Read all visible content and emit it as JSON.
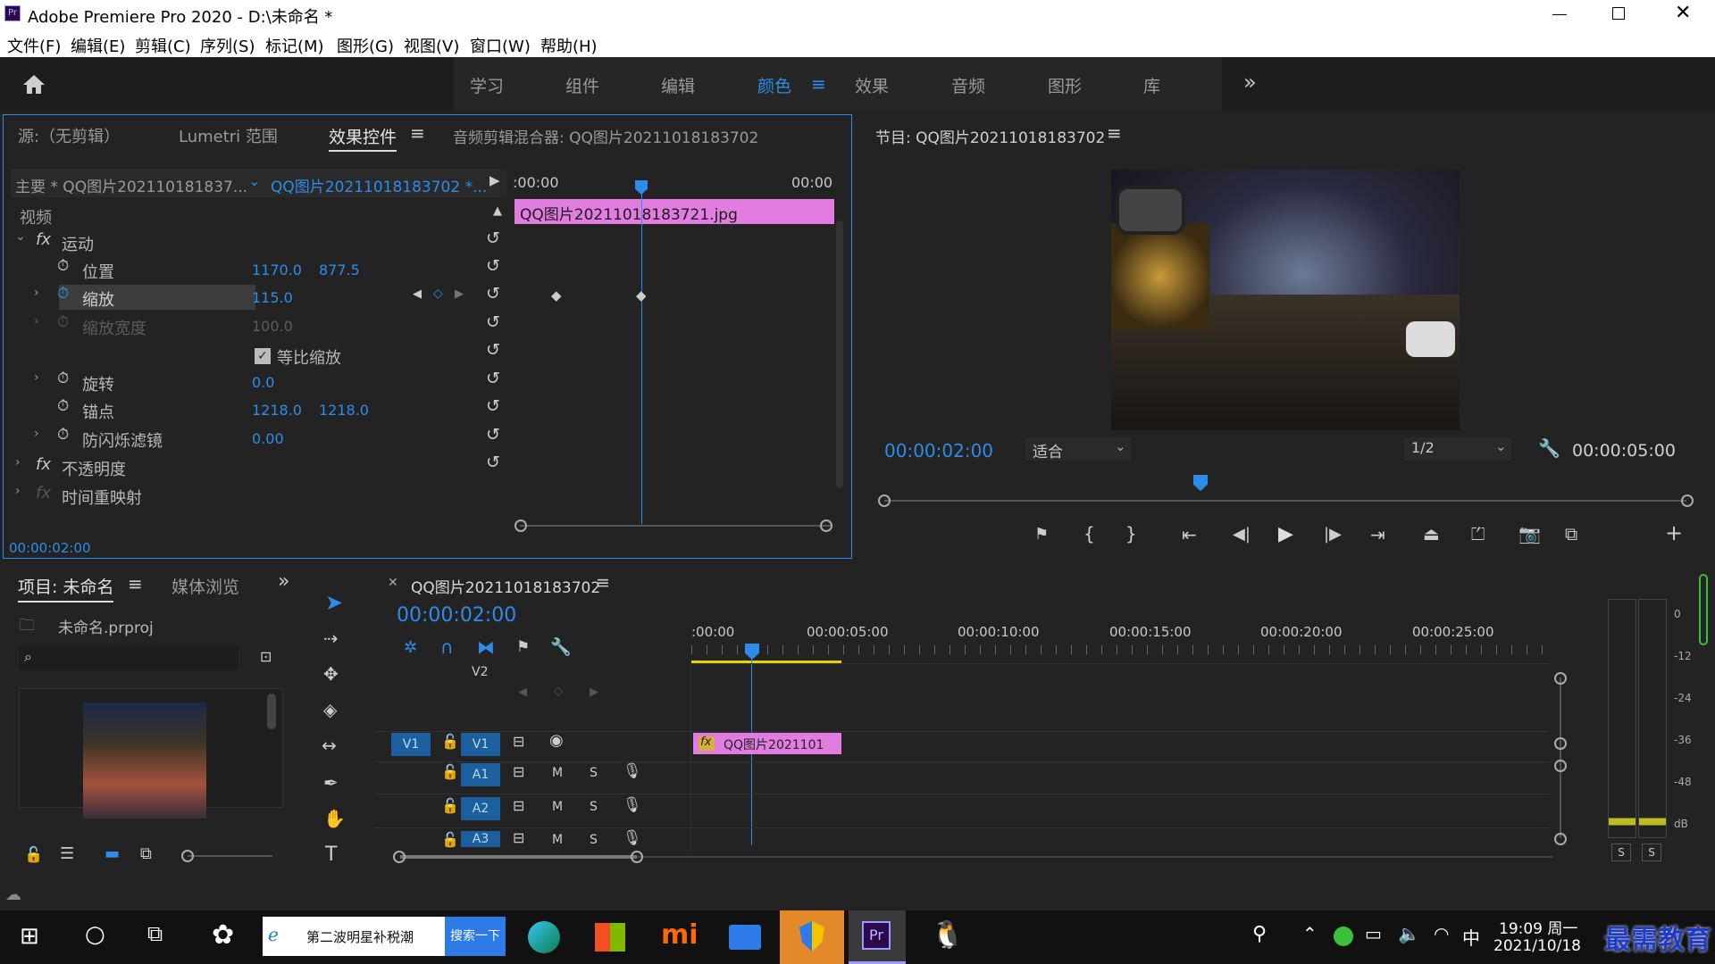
{
  "window": {
    "title": "Adobe Premiere Pro 2020 - D:\\未命名 *"
  },
  "menu": [
    "文件(F)",
    "编辑(E)",
    "剪辑(C)",
    "序列(S)",
    "标记(M)",
    "图形(G)",
    "视图(V)",
    "窗口(W)",
    "帮助(H)"
  ],
  "workspaces": [
    "学习",
    "组件",
    "编辑",
    "颜色",
    "效果",
    "音频",
    "图形",
    "库"
  ],
  "active_workspace": "颜色",
  "source_tabs": [
    "源:（无剪辑）",
    "Lumetri 范围",
    "效果控件",
    "音频剪辑混合器: QQ图片20211018183702"
  ],
  "ec": {
    "master": "主要 * QQ图片202110181837...",
    "clip": "QQ图片20211018183702 *...",
    "tc_start": ":00:00",
    "tc_end": "00:00",
    "clip_bar": "QQ图片20211018183721.jpg",
    "video_label": "视频",
    "motion": "运动",
    "position": "位置",
    "pos_x": "1170.0",
    "pos_y": "877.5",
    "scale": "缩放",
    "scale_val": "115.0",
    "scale_width": "缩放宽度",
    "scale_width_val": "100.0",
    "uniform": "等比缩放",
    "rotation": "旋转",
    "rotation_val": "0.0",
    "anchor": "锚点",
    "anchor_x": "1218.0",
    "anchor_y": "1218.0",
    "flicker": "防闪烁滤镜",
    "flicker_val": "0.00",
    "opacity": "不透明度",
    "time_remap": "时间重映射",
    "timecode": "00:00:02:00"
  },
  "program": {
    "title": "节目: QQ图片20211018183702",
    "timecode": "00:00:02:00",
    "fit": "适合",
    "res": "1/2",
    "duration": "00:00:05:00"
  },
  "project": {
    "tab": "项目: 未命名",
    "media_tab": "媒体浏览",
    "file": "未命名.prproj"
  },
  "timeline": {
    "tab": "QQ图片20211018183702",
    "timecode": "00:00:02:00",
    "ruler": [
      ":00:00",
      "00:00:05:00",
      "00:00:10:00",
      "00:00:15:00",
      "00:00:20:00",
      "00:00:25:00"
    ],
    "v2": "V2",
    "v1": "V1",
    "a1": "A1",
    "a2": "A2",
    "a3": "A3",
    "m": "M",
    "s": "S",
    "clip": "QQ图片2021101",
    "fx": "fx"
  },
  "meter": {
    "scale": [
      "0",
      "-12",
      "-24",
      "-36",
      "-48",
      "dB"
    ],
    "solo": "S"
  },
  "taskbar": {
    "search_text": "第二波明星补税潮",
    "search_btn": "搜索一下",
    "time": "19:09 周一",
    "date": "2021/10/18",
    "ime": "中",
    "watermark": "最需教育"
  }
}
